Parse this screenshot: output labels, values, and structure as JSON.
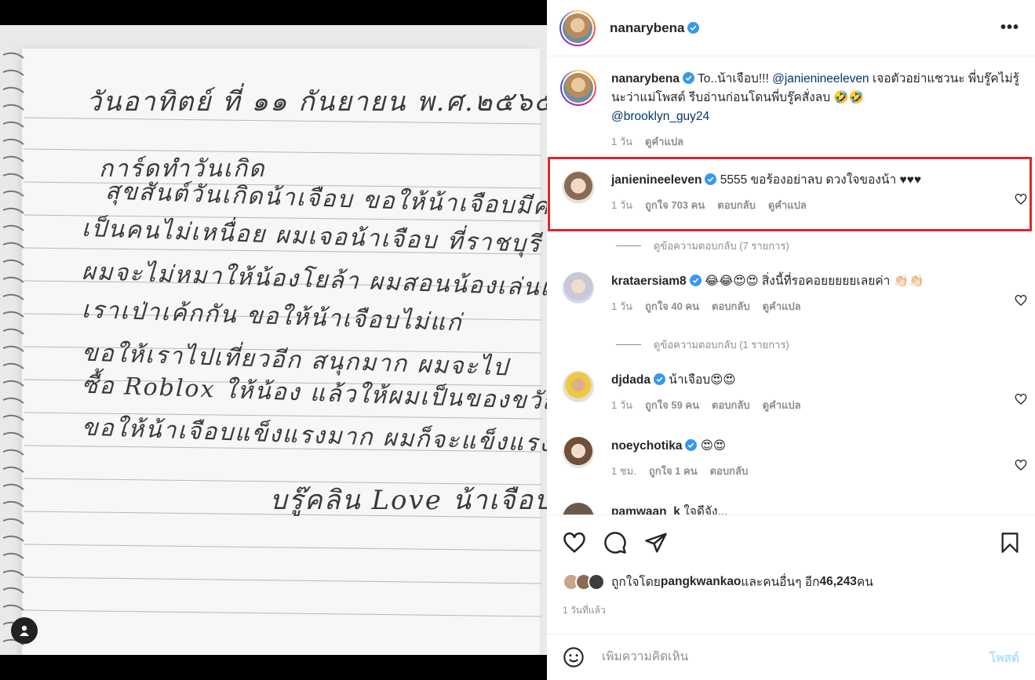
{
  "post": {
    "author": "nanarybena",
    "more_icon": "more-horizontal-icon",
    "note_lines": [
      "วันอาทิตย์ ที่ ๑๑ กันยายน พ.ศ.๒๕๖๕",
      "การ์ดทำวันเกิด",
      "สุขสันต์วันเกิดน้าเจือบ ขอให้น้าเจือบมีความสุข",
      "เป็นคนไม่เหนื่อย ผมเจอน้าเจือบ ที่ราชบุรี",
      "ผมจะไม่หมาให้น้องโยล้า ผมสอนน้องเล่นเกม",
      "เราเป่าเค้กกัน ขอให้น้าเจือบไม่แก่",
      "ขอให้เราไปเที่ยวอีก สนุกมาก ผมจะไป",
      "ซื้อ Roblox ให้น้อง แล้วให้ผมเป็นของขวัญวันเกิด",
      "ขอให้น้าเจือบแข็งแรงมาก ผมก็จะแข็งแรง",
      "บรู๊คลิน Love น้าเจือบ"
    ]
  },
  "caption": {
    "username": "nanarybena",
    "text_prefix": "To..น้าเจือบ!!! ",
    "mention1": "@janienineeleven",
    "text_mid": " เจอตัวอย่าแซวนะ พี่บรู๊คไม่รู้นะว่าแม่โพสต์ รีบอ่านก่อนโดนพี่บรู๊คสั่งลบ 🤣🤣",
    "mention2": "@brooklyn_guy24",
    "time": "1 วัน",
    "translate": "ดูคำแปล"
  },
  "comments": [
    {
      "username": "janienineeleven",
      "text": "5555 ขอร้องอย่าลบ ดวงใจของน้า ♥♥♥",
      "time": "1 วัน",
      "likes": "ถูกใจ 703 คน",
      "reply": "ตอบกลับ",
      "translate": "ดูคำแปล",
      "view_replies": "ดูข้อความตอบกลับ (7 รายการ)"
    },
    {
      "username": "krataersiam8",
      "text": "😂😂😍😍 สิ่งนี้ที่รอคอยยยยยเลยค่า 👏🏻👏🏻",
      "time": "1 วัน",
      "likes": "ถูกใจ 40 คน",
      "reply": "ตอบกลับ",
      "translate": "ดูคำแปล",
      "view_replies": "ดูข้อความตอบกลับ (1 รายการ)"
    },
    {
      "username": "djdada",
      "text": "น้าเจือบ😍😍",
      "time": "1 วัน",
      "likes": "ถูกใจ 59 คน",
      "reply": "ตอบกลับ",
      "translate": "ดูคำแปล"
    },
    {
      "username": "noeychotika",
      "text": "😍😍",
      "time": "1 ชม.",
      "likes": "ถูกใจ 1 คน",
      "reply": "ตอบกลับ"
    },
    {
      "username": "pamwaan_k",
      "text": "ใจดีจัง..."
    }
  ],
  "actions": {
    "like_icon": "heart-icon",
    "comment_icon": "comment-icon",
    "share_icon": "share-icon",
    "save_icon": "bookmark-icon"
  },
  "likes": {
    "prefix": "ถูกใจโดย ",
    "user": "pangkwankao",
    "mid": " และคนอื่นๆ อีก ",
    "count": "46,243",
    "suffix": " คน"
  },
  "posted_time": "1 วันที่แล้ว",
  "add_comment": {
    "placeholder": "เพิ่มความคิดเห็น",
    "post_label": "โพสต์"
  },
  "colors": {
    "highlight": "#e3242b",
    "verified": "#3897f0",
    "link": "#00376b",
    "muted": "#8e8e8e"
  }
}
